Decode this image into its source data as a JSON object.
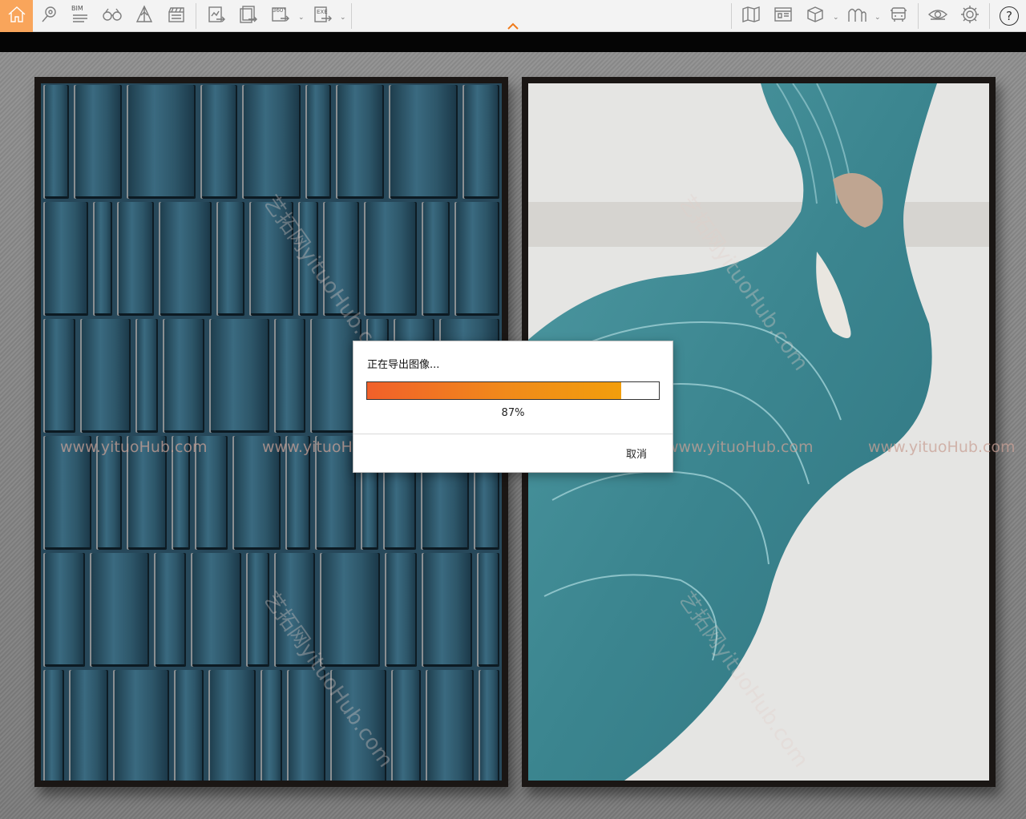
{
  "toolbar": {
    "bim_label": "BIM",
    "left_icons": [
      "home-icon",
      "map-pin-icon",
      "bim-list-icon",
      "binoculars-icon",
      "pyramid-icon",
      "clapperboard-icon"
    ],
    "export_icons": [
      "export-image-icon",
      "export-batch-icon",
      "export-360-icon",
      "export-exe-icon"
    ],
    "right_icons": [
      "map-icon",
      "floorplan-icon",
      "cube-icon",
      "arches-icon",
      "bus-icon",
      "eye-icon",
      "gear-icon",
      "help-icon"
    ],
    "export_360_label": "360°",
    "export_exe_label": "EXE",
    "help_label": "?"
  },
  "watermark": {
    "text": "www.yituoHub.com",
    "diagonal_text": "艺拓网yituoHub.com"
  },
  "dialog": {
    "title": "正在导出图像...",
    "progress_value": 0.87,
    "progress_label": "87%",
    "cancel_label": "取消"
  },
  "colors": {
    "accent": "#f07a1a",
    "home_bg": "#f9a55b"
  }
}
